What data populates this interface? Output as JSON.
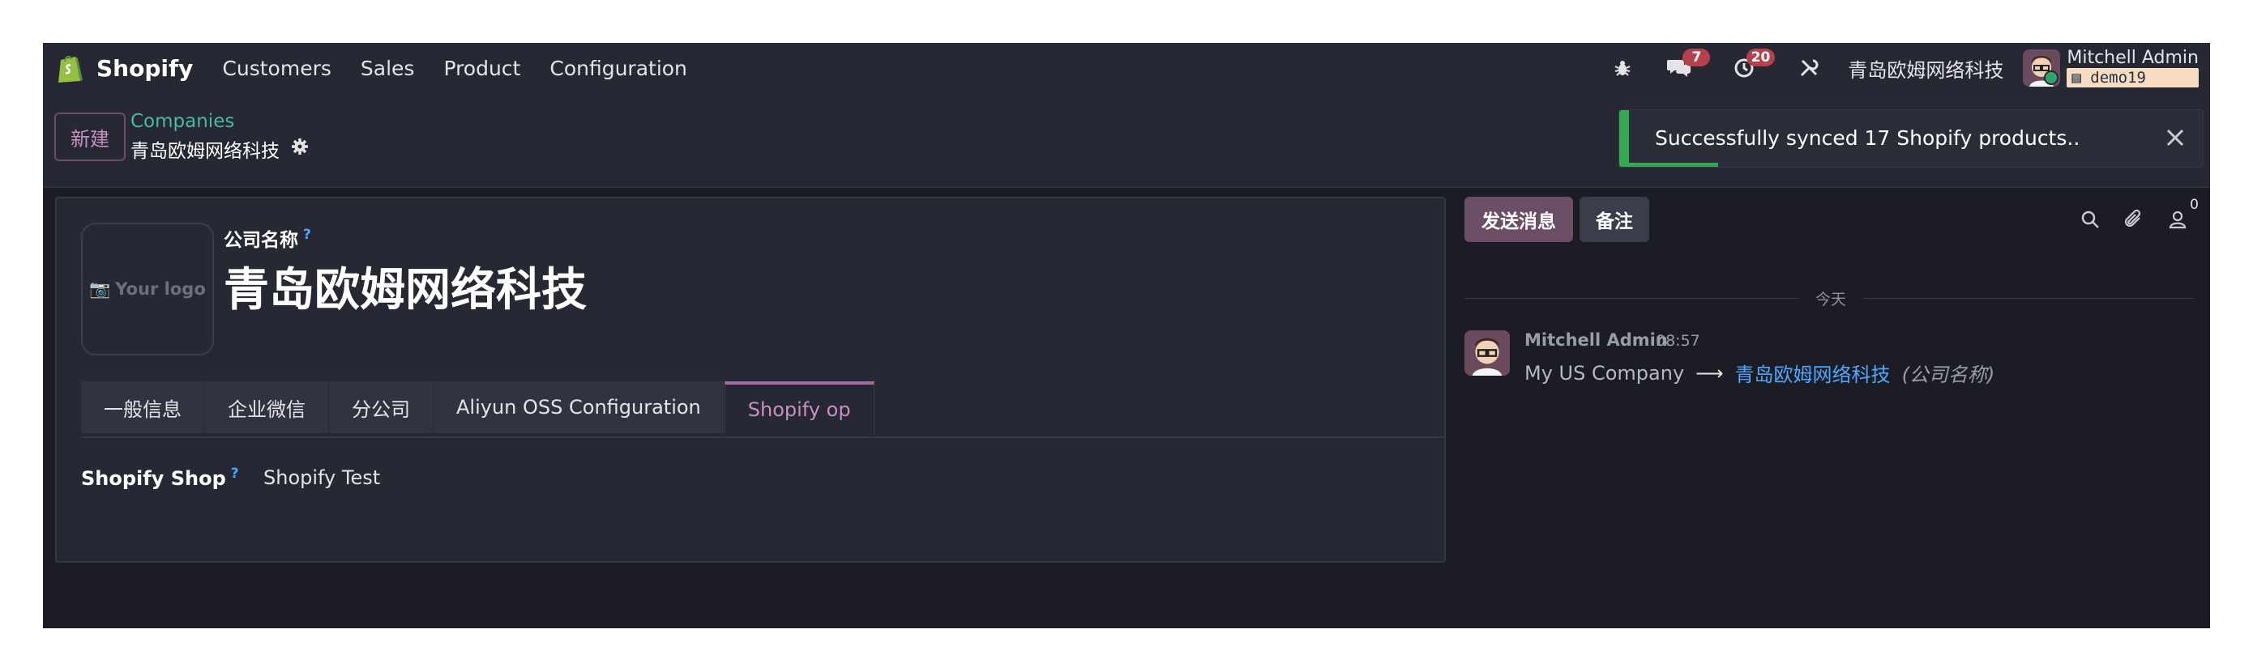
{
  "topbar": {
    "app_name": "Shopify",
    "menu": [
      "Customers",
      "Sales",
      "Product",
      "Configuration"
    ],
    "messages_count": "7",
    "activities_count": "20",
    "company": "青岛欧姆网络科技",
    "user_name": "Mitchell Admin",
    "database": "demo19"
  },
  "control": {
    "new_label": "新建",
    "breadcrumb_parent": "Companies",
    "breadcrumb_current": "青岛欧姆网络科技"
  },
  "toast": {
    "message": "Successfully synced 17 Shopify products..",
    "progress": 0.17
  },
  "form": {
    "logo_placeholder": "Your logo",
    "name_label": "公司名称",
    "help_mark": "?",
    "company_name": "青岛欧姆网络科技",
    "tabs": [
      "一般信息",
      "企业微信",
      "分公司",
      "Aliyun OSS Configuration",
      "Shopify op"
    ],
    "active_tab": "Shopify op",
    "shop_label": "Shopify Shop",
    "shop_value": "Shopify Test"
  },
  "chatter": {
    "send_label": "发送消息",
    "note_label": "备注",
    "followers_count": "0",
    "date_label": "今天",
    "message": {
      "author": "Mitchell Admin",
      "time": "08:57",
      "old_value": "My US Company",
      "arrow": "⟶",
      "new_value": "青岛欧姆网络科技",
      "field": "(公司名称)"
    }
  },
  "colors": {
    "brand": "#95bf47",
    "accent": "#a86aa0",
    "link_teal": "#49b7a9",
    "success": "#34a853",
    "badge": "#b6404b"
  }
}
